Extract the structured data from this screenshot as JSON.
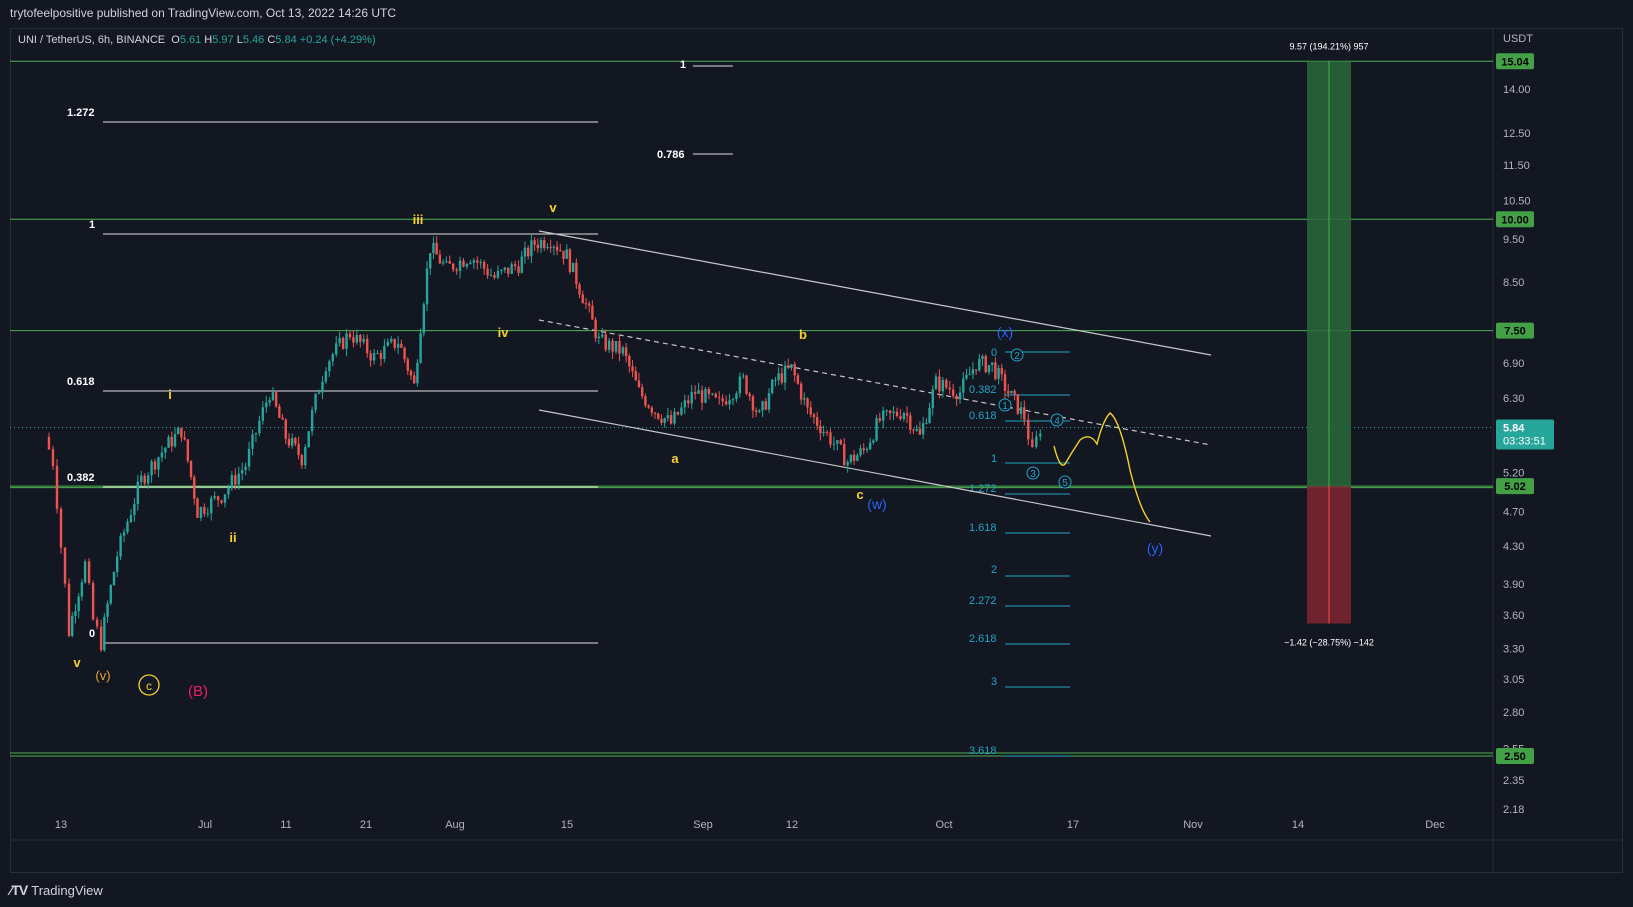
{
  "header": {
    "published": "trytofeelpositive published on TradingView.com, Oct 13, 2022 14:26 UTC",
    "symbol": "UNI / TetherUS, 6h, BINANCE",
    "o_label": "O",
    "o_val": "5.61",
    "h_label": "H",
    "h_val": "5.97",
    "l_label": "L",
    "l_val": "5.46",
    "c_label": "C",
    "c_val": "5.84",
    "change": "+0.24 (+4.29%)"
  },
  "brand": {
    "name": "TradingView"
  },
  "colors": {
    "bg": "#131722",
    "up": "#26a69a",
    "down": "#ef5350",
    "green_line": "#4caf50",
    "wave_yellow": "#f5d22e",
    "wave_blue": "#2962ff",
    "fib_cyan": "#22a4c2",
    "profit": "#2a6a3a",
    "loss": "#7a2530"
  },
  "chart_data": {
    "type": "candlestick",
    "symbol": "UNI / TetherUS",
    "interval": "6h",
    "exchange": "BINANCE",
    "y_axis_unit": "USDT",
    "y_scale": "log",
    "ylim": [
      2.15,
      16.5
    ],
    "y_ticks": [
      "14.00",
      "12.50",
      "11.50",
      "10.50",
      "9.50",
      "8.50",
      "6.90",
      "6.30",
      "5.20",
      "4.70",
      "4.30",
      "3.90",
      "3.60",
      "3.30",
      "3.05",
      "2.80",
      "2.55",
      "2.35",
      "2.18"
    ],
    "x_ticks": [
      "13",
      "Jul",
      "11",
      "21",
      "Aug",
      "15",
      "Sep",
      "12",
      "Oct",
      "17",
      "Nov",
      "14",
      "Dec"
    ],
    "last_price": "5.84",
    "countdown": "03:33:51",
    "horizontal_levels": [
      "15.04",
      "10.00",
      "7.50",
      "5.02",
      "2.50"
    ],
    "price_path": [
      {
        "d": "Jun 11",
        "p": 5.7
      },
      {
        "d": "Jun 12",
        "p": 5.35
      },
      {
        "d": "Jun 13",
        "p": 4.3
      },
      {
        "d": "Jun 14",
        "p": 3.45
      },
      {
        "d": "Jun 16",
        "p": 4.1
      },
      {
        "d": "Jun 17",
        "p": 3.55
      },
      {
        "d": "Jun 18",
        "p": 3.35
      },
      {
        "d": "Jun 20",
        "p": 4.2
      },
      {
        "d": "Jun 23",
        "p": 5.1
      },
      {
        "d": "Jun 26",
        "p": 5.55
      },
      {
        "d": "Jun 28",
        "p": 5.8
      },
      {
        "d": "Jun 30",
        "p": 4.7
      },
      {
        "d": "Jul 3",
        "p": 4.9
      },
      {
        "d": "Jul 6",
        "p": 5.3
      },
      {
        "d": "Jul 9",
        "p": 6.4
      },
      {
        "d": "Jul 11",
        "p": 5.7
      },
      {
        "d": "Jul 13",
        "p": 5.4
      },
      {
        "d": "Jul 16",
        "p": 6.9
      },
      {
        "d": "Jul 19",
        "p": 7.45
      },
      {
        "d": "Jul 22",
        "p": 7.0
      },
      {
        "d": "Jul 25",
        "p": 7.3
      },
      {
        "d": "Jul 27",
        "p": 6.5
      },
      {
        "d": "Jul 29",
        "p": 9.3
      },
      {
        "d": "Jul 31",
        "p": 8.8
      },
      {
        "d": "Aug 3",
        "p": 9.1
      },
      {
        "d": "Aug 6",
        "p": 8.6
      },
      {
        "d": "Aug 9",
        "p": 8.9
      },
      {
        "d": "Aug 11",
        "p": 9.4
      },
      {
        "d": "Aug 13",
        "p": 9.5
      },
      {
        "d": "Aug 15",
        "p": 9.1
      },
      {
        "d": "Aug 17",
        "p": 8.2
      },
      {
        "d": "Aug 19",
        "p": 7.3
      },
      {
        "d": "Aug 22",
        "p": 7.1
      },
      {
        "d": "Aug 24",
        "p": 6.4
      },
      {
        "d": "Aug 26",
        "p": 6.1
      },
      {
        "d": "Aug 28",
        "p": 5.9
      },
      {
        "d": "Aug 31",
        "p": 6.4
      },
      {
        "d": "Sep 3",
        "p": 6.2
      },
      {
        "d": "Sep 6",
        "p": 6.6
      },
      {
        "d": "Sep 8",
        "p": 6.0
      },
      {
        "d": "Sep 10",
        "p": 6.6
      },
      {
        "d": "Sep 12",
        "p": 6.8
      },
      {
        "d": "Sep 14",
        "p": 6.1
      },
      {
        "d": "Sep 16",
        "p": 5.8
      },
      {
        "d": "Sep 19",
        "p": 5.35
      },
      {
        "d": "Sep 21",
        "p": 5.5
      },
      {
        "d": "Sep 23",
        "p": 5.95
      },
      {
        "d": "Sep 26",
        "p": 6.1
      },
      {
        "d": "Sep 28",
        "p": 5.7
      },
      {
        "d": "Sep 30",
        "p": 6.55
      },
      {
        "d": "Oct 3",
        "p": 6.4
      },
      {
        "d": "Oct 5",
        "p": 6.9
      },
      {
        "d": "Oct 7",
        "p": 6.85
      },
      {
        "d": "Oct 9",
        "p": 6.4
      },
      {
        "d": "Oct 11",
        "p": 6.0
      },
      {
        "d": "Oct 12",
        "p": 5.45
      },
      {
        "d": "Oct 13",
        "p": 5.84
      }
    ]
  },
  "axis_extra": {
    "usdt": "USDT"
  },
  "labels": {
    "yellow_waves": [
      {
        "t": "iii"
      },
      {
        "t": "v"
      },
      {
        "t": "iv"
      },
      {
        "t": "i"
      },
      {
        "t": "ii"
      },
      {
        "t": "v"
      },
      {
        "t": "a"
      },
      {
        "t": "b"
      },
      {
        "t": "c"
      }
    ],
    "orange_v": "(v)",
    "yellow_c": "c",
    "pink_B": "(B)",
    "blue_w": "(w)",
    "blue_x": "(x)",
    "blue_y": "(y)",
    "circled": [
      "2",
      "1",
      "3",
      "4",
      "5"
    ],
    "fib_white": [
      {
        "t": "1"
      },
      {
        "t": "1.272"
      },
      {
        "t": "0.786"
      },
      {
        "t": "1"
      },
      {
        "t": "0.618"
      },
      {
        "t": "0.382"
      },
      {
        "t": "0"
      }
    ],
    "fib_cyan": [
      "0",
      "0.382",
      "0.618",
      "1",
      "1.272",
      "1.618",
      "2",
      "2.272",
      "2.618",
      "3",
      "3.618"
    ],
    "top_measure": "9.57 (194.21%) 957",
    "bottom_measure": "−1.42 (−28.75%) −142"
  }
}
